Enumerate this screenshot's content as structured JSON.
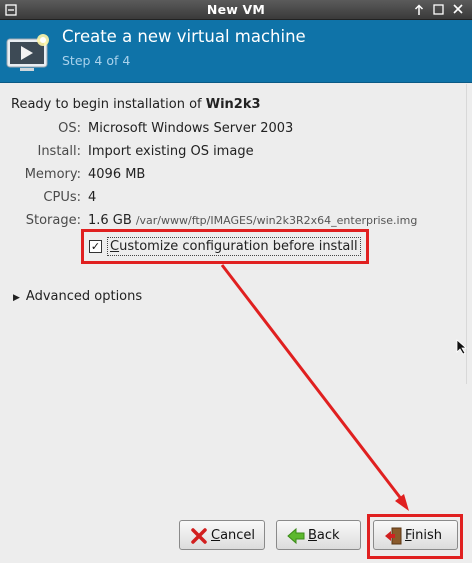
{
  "window": {
    "title": "New VM",
    "menu_icon": "window-menu-icon",
    "up_icon": "arrow-up-icon",
    "restore_icon": "restore-icon",
    "close_icon": "close-icon"
  },
  "header": {
    "title": "Create a new virtual machine",
    "step": "Step 4 of 4",
    "icon": "new-vm-icon"
  },
  "summary": {
    "ready_prefix": "Ready to begin installation of ",
    "vm_name": "Win2k3",
    "rows": [
      {
        "label": "OS:",
        "value": "Microsoft Windows Server 2003"
      },
      {
        "label": "Install:",
        "value": "Import existing OS image"
      },
      {
        "label": "Memory:",
        "value": "4096 MB"
      },
      {
        "label": "CPUs:",
        "value": "4"
      },
      {
        "label": "Storage:",
        "value": "1.6 GB",
        "path": "/var/www/ftp/IMAGES/win2k3R2x64_enterprise.img"
      }
    ]
  },
  "customize": {
    "checked": true,
    "check_glyph": "✓",
    "mnemonic": "C",
    "label_rest": "ustomize configuration before install"
  },
  "advanced": {
    "label": "Advanced options",
    "expander_icon": "expander-right-icon"
  },
  "buttons": {
    "cancel": {
      "mnemonic": "C",
      "rest": "ancel",
      "icon": "cancel-x-icon"
    },
    "back": {
      "mnemonic": "B",
      "rest": "ack",
      "icon": "back-arrow-icon"
    },
    "finish": {
      "mnemonic": "F",
      "rest": "inish",
      "icon": "finish-door-icon"
    }
  },
  "colors": {
    "header_bg": "#0f73a8",
    "step_text": "#a9d2ec",
    "annotation": "#e02020"
  }
}
